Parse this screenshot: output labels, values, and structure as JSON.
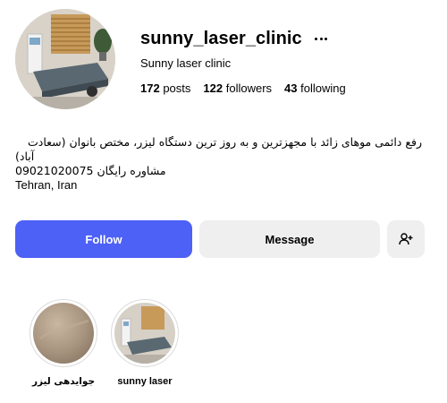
{
  "profile": {
    "username": "sunny_laser_clinic",
    "full_name": "Sunny laser clinic",
    "stats": {
      "posts_count": "172",
      "posts_label": "posts",
      "followers_count": "122",
      "followers_label": "followers",
      "following_count": "43",
      "following_label": "following"
    },
    "bio": {
      "line1": "رفع دائمی موهای زائد با مجهزترین و به روز ترین دستگاه لیزر، مختص بانوان (سعادت",
      "line2": "آباد)",
      "line3": "مشاوره رایگان 09021020075",
      "line4": "Tehran, Iran"
    }
  },
  "actions": {
    "follow_label": "Follow",
    "message_label": "Message",
    "add_user_icon": "person-add-icon"
  },
  "highlights": [
    {
      "label": "جوایدهی لیزر",
      "thumb": "skin-closeup"
    },
    {
      "label": "sunny laser",
      "thumb": "treatment-room"
    }
  ],
  "colors": {
    "follow_button": "#4d61f6",
    "secondary_button": "#efefef",
    "text": "#000000"
  }
}
